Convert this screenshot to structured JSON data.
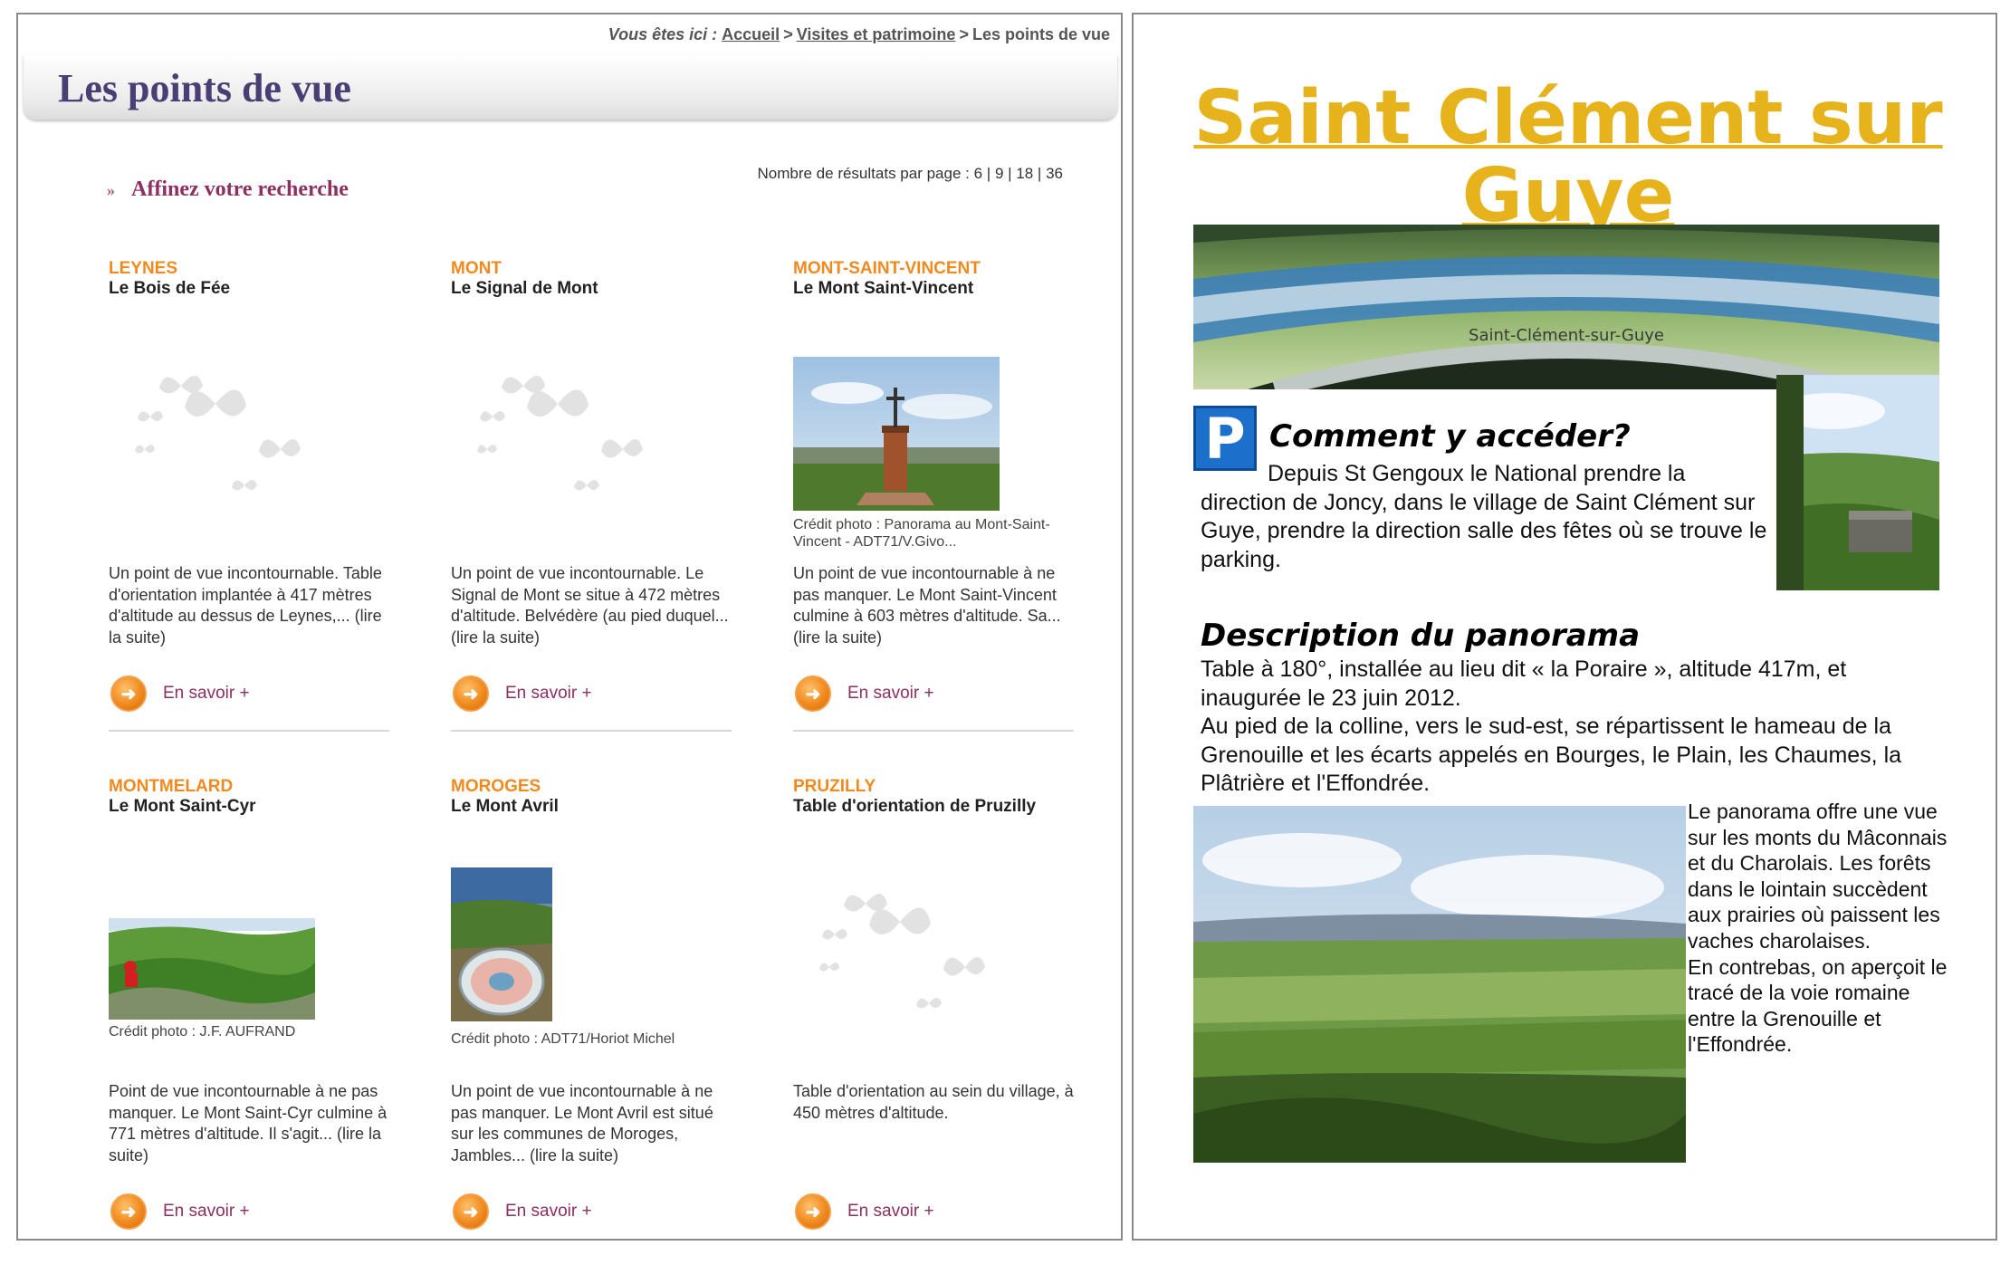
{
  "site": {
    "breadcrumb": {
      "intro": "Vous êtes ici :",
      "home": "Accueil",
      "section": "Visites et patrimoine",
      "current": "Les points de vue"
    },
    "page_title": "Les points de vue",
    "refine_label": "Affinez votre recherche",
    "per_page": {
      "label": "Nombre de résultats par page :",
      "options": [
        "6",
        "9",
        "18",
        "36"
      ]
    },
    "more_label": "En savoir +",
    "cards": [
      {
        "town": "LEYNES",
        "site": "Le Bois de Fée",
        "photo": "none",
        "credit": "",
        "description": "Un point de vue incontournable. Table d'orientation implantée à 417 mètres d'altitude au dessus de Leynes,... (lire la suite)"
      },
      {
        "town": "MONT",
        "site": "Le Signal de Mont",
        "photo": "none",
        "credit": "",
        "description": "Un point de vue incontournable. Le Signal de Mont se situe à 472 mètres d'altitude. Belvédère (au pied duquel... (lire la suite)"
      },
      {
        "town": "MONT-SAINT-VINCENT",
        "site": "Le Mont Saint-Vincent",
        "photo": "tower-cross",
        "credit": "Crédit photo : Panorama au Mont-Saint-Vincent - ADT71/V.Givo...",
        "description": "Un point de vue incontournable à ne pas manquer. Le Mont Saint-Vincent culmine à 603 mètres d'altitude. Sa... (lire la suite)"
      },
      {
        "town": "MONTMELARD",
        "site": "Le Mont Saint-Cyr",
        "photo": "hills",
        "credit": "Crédit photo : J.F. AUFRAND",
        "description": "Point de vue incontournable à ne pas manquer. Le Mont Saint-Cyr culmine à 771 mètres d'altitude. Il s'agit... (lire la suite)"
      },
      {
        "town": "MOROGES",
        "site": "Le Mont Avril",
        "photo": "orientation-table",
        "credit": "Crédit photo : ADT71/Horiot Michel",
        "description": "Un point de vue incontournable à ne pas manquer. Le Mont Avril est situé sur les communes de Moroges, Jambles... (lire la suite)"
      },
      {
        "town": "PRUZILLY",
        "site": "Table d'orientation de Pruzilly",
        "photo": "none",
        "credit": "",
        "description": "Table d'orientation au sein du village, à 450 mètres d'altitude."
      }
    ],
    "colors": {
      "title": "#4a3f74",
      "town": "#f08a1f",
      "accent": "#8d2f61"
    }
  },
  "brochure": {
    "title": "Saint Clément sur Guye",
    "access_heading": "Comment y accéder?",
    "parking_icon": "P",
    "access_text": "Depuis St Gengoux le National prendre la direction de Joncy, dans le village de Saint Clément sur Guye, prendre la direction salle des fêtes où se trouve le parking.",
    "description_heading": "Description du panorama",
    "description_text_1": "Table à 180°, installée au lieu dit « la Poraire », altitude  417m,  et inaugurée le 23 juin 2012.",
    "description_text_2": "Au pied de la colline, vers le sud-est, se répartissent le hameau de la Grenouille et les écarts appelés en Bourges, le Plain, les Chaumes, la Plâtrière et l'Effondrée.",
    "panorama_text_1": "Le panorama offre une vue sur les monts du Mâconnais et du Charolais. Les forêts dans le lointain succèdent aux prairies où paissent les vaches charolaises.",
    "panorama_text_2": "En contrebas, on aperçoit le tracé de la voie romaine entre la Grenouille et l'Effondrée.",
    "table_inscription": "Saint-Clément-sur-Guye",
    "colors": {
      "title": "#e6b31c",
      "parking": "#1c6fcb"
    }
  }
}
